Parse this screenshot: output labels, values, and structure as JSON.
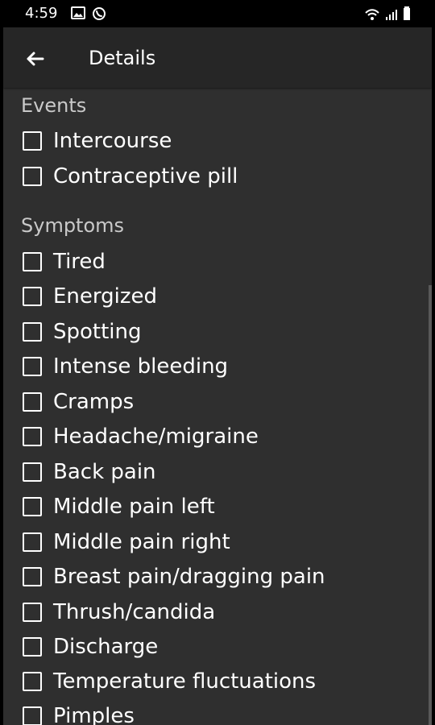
{
  "status_bar": {
    "time": "4:59",
    "left_icons": [
      "image-icon",
      "whatsapp-icon"
    ],
    "right_icons": [
      "wifi-icon",
      "signal-icon",
      "battery-icon"
    ]
  },
  "app_bar": {
    "title": "Details",
    "back_icon": "back-arrow-icon"
  },
  "sections": [
    {
      "title": "Events",
      "items": [
        {
          "label": "Intercourse",
          "checked": false
        },
        {
          "label": "Contraceptive pill",
          "checked": false
        }
      ]
    },
    {
      "title": "Symptoms",
      "items": [
        {
          "label": "Tired",
          "checked": false
        },
        {
          "label": "Energized",
          "checked": false
        },
        {
          "label": "Spotting",
          "checked": false
        },
        {
          "label": "Intense bleeding",
          "checked": false
        },
        {
          "label": "Cramps",
          "checked": false
        },
        {
          "label": "Headache/migraine",
          "checked": false
        },
        {
          "label": "Back pain",
          "checked": false
        },
        {
          "label": "Middle pain left",
          "checked": false
        },
        {
          "label": "Middle pain right",
          "checked": false
        },
        {
          "label": "Breast pain/dragging pain",
          "checked": false
        },
        {
          "label": "Thrush/candida",
          "checked": false
        },
        {
          "label": "Discharge",
          "checked": false
        },
        {
          "label": "Temperature fluctuations",
          "checked": false
        },
        {
          "label": "Pimples",
          "checked": false
        }
      ]
    }
  ],
  "colors": {
    "background": "#2f2f2f",
    "app_bar": "#262626",
    "text": "#ffffff",
    "section_title": "#c9c9c9"
  }
}
